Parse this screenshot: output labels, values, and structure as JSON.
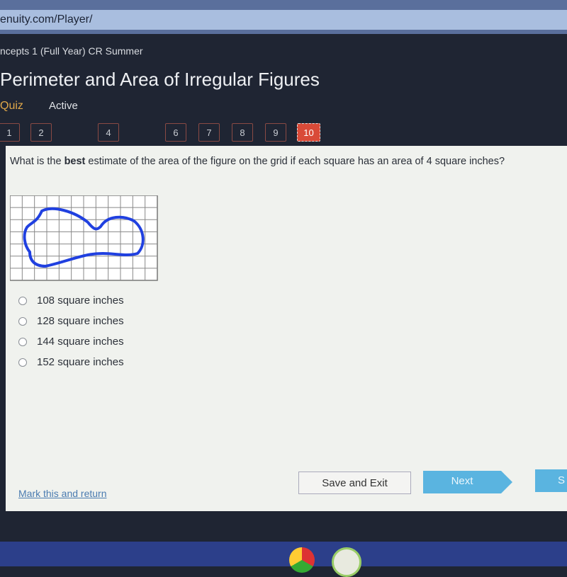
{
  "browser": {
    "url": "enuity.com/Player/"
  },
  "header": {
    "course": "ncepts 1 (Full Year) CR Summer",
    "title": "Perimeter and Area of Irregular Figures",
    "type": "Quiz",
    "status": "Active"
  },
  "question_nav": [
    {
      "label": "1"
    },
    {
      "label": "2"
    },
    {
      "label": "4"
    },
    {
      "label": "6"
    },
    {
      "label": "7"
    },
    {
      "label": "8"
    },
    {
      "label": "9"
    },
    {
      "label": "10",
      "current": true
    }
  ],
  "question": {
    "prefix": "What is the ",
    "bold": "best",
    "suffix": " estimate of the area of the figure on the grid if each square has an area of 4 square inches?"
  },
  "options": [
    "108 square inches",
    "128 square inches",
    "144 square inches",
    "152 square inches"
  ],
  "footer": {
    "mark_link": "Mark this and return",
    "save_exit": "Save and Exit",
    "next": "Next",
    "submit": "S"
  },
  "colors": {
    "current_question": "#d94a38",
    "next_button": "#5ab4e0",
    "figure_outline": "#2040e0"
  },
  "taskbar": {
    "icons": [
      "chrome-icon",
      "app-icon"
    ]
  }
}
